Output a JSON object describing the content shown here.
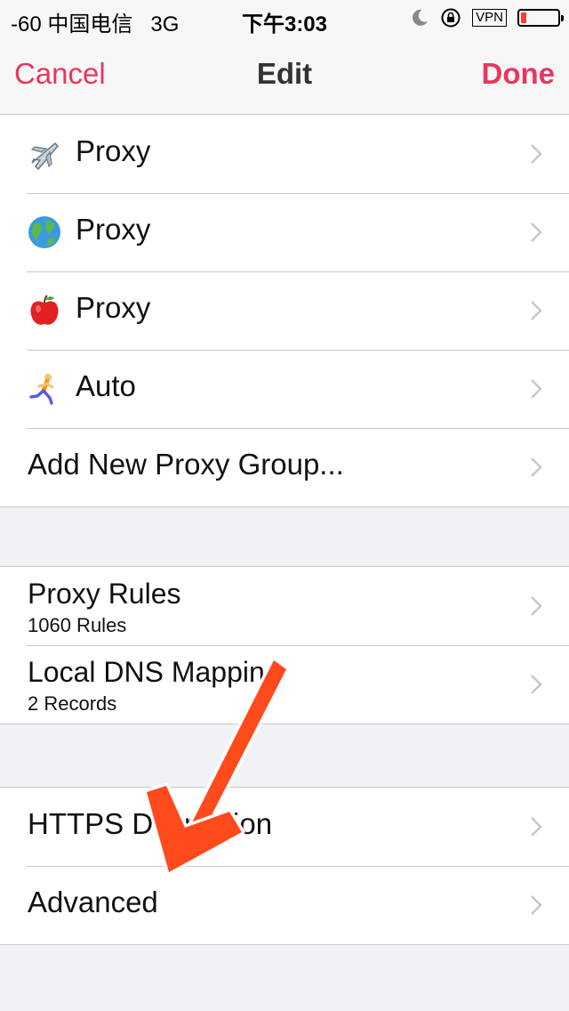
{
  "status_bar": {
    "signal": "-60",
    "carrier": "中国电信",
    "network": "3G",
    "time": "下午3:03",
    "vpn": "VPN",
    "battery_level": 0.15,
    "icons": [
      "moon-icon",
      "rotation-lock-icon"
    ]
  },
  "nav": {
    "cancel": "Cancel",
    "title": "Edit",
    "done": "Done",
    "accent_color": "#e8375f"
  },
  "proxy_groups": [
    {
      "icon": "airplane-icon",
      "label": "Proxy"
    },
    {
      "icon": "globe-icon",
      "label": "Proxy"
    },
    {
      "icon": "apple-icon",
      "label": "Proxy"
    },
    {
      "icon": "runner-icon",
      "label": "Auto"
    },
    {
      "icon": null,
      "label": "Add New Proxy Group..."
    }
  ],
  "rules": [
    {
      "title": "Proxy Rules",
      "subtitle": "1060 Rules"
    },
    {
      "title": "Local DNS Mapping",
      "subtitle": "2 Records"
    }
  ],
  "misc": [
    {
      "label": "HTTPS Decryption"
    },
    {
      "label": "Advanced"
    }
  ],
  "annotation": {
    "color": "#ff4a1c"
  }
}
